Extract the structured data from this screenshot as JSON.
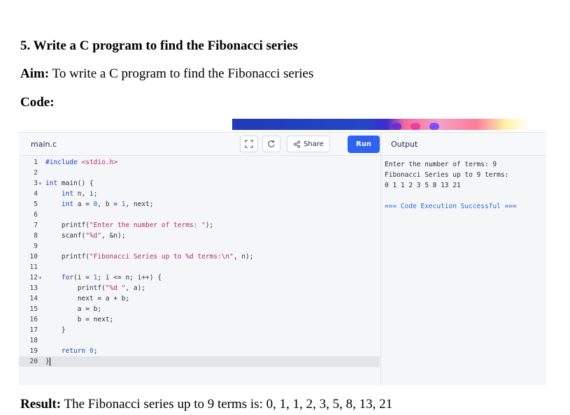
{
  "document": {
    "heading": "5.  Write a C program to find the Fibonacci series",
    "aim_label": "Aim:",
    "aim_text": " To write a C program to find the Fibonacci series",
    "code_label": "Code:",
    "result_label": "Result:",
    "result_text": " The Fibonacci series up to 9 terms is: 0, 1, 1, 2, 3, 5, 8, 13, 21"
  },
  "editor": {
    "file_name": "main.c",
    "share_label": "Share",
    "run_label": "Run",
    "icons": [
      "fullscreen-icon",
      "theme-toggle-icon",
      "share-icon"
    ],
    "lines": [
      {
        "n": "1",
        "code": "#include <stdio.h>"
      },
      {
        "n": "2",
        "code": ""
      },
      {
        "n": "3",
        "code": "int main() {",
        "fold": true
      },
      {
        "n": "4",
        "code": "    int n, i;"
      },
      {
        "n": "5",
        "code": "    int a = 0, b = 1, next;"
      },
      {
        "n": "6",
        "code": ""
      },
      {
        "n": "7",
        "code": "    printf(\"Enter the number of terms: \");"
      },
      {
        "n": "8",
        "code": "    scanf(\"%d\", &n);"
      },
      {
        "n": "9",
        "code": ""
      },
      {
        "n": "10",
        "code": "    printf(\"Fibonacci Series up to %d terms:\\n\", n);"
      },
      {
        "n": "11",
        "code": ""
      },
      {
        "n": "12",
        "code": "    for(i = 1; i <= n; i++) {",
        "fold": true
      },
      {
        "n": "13",
        "code": "        printf(\"%d \", a);"
      },
      {
        "n": "14",
        "code": "        next = a + b;"
      },
      {
        "n": "15",
        "code": "        a = b;"
      },
      {
        "n": "16",
        "code": "        b = next;"
      },
      {
        "n": "17",
        "code": "    }"
      },
      {
        "n": "18",
        "code": ""
      },
      {
        "n": "19",
        "code": "    return 0;"
      },
      {
        "n": "20",
        "code": "}",
        "active": true
      }
    ]
  },
  "output": {
    "label": "Output",
    "lines": [
      "Enter the number of terms: 9",
      "Fibonacci Series up to 9 terms:",
      "0 1 1 2 3 5 8 13 21",
      "",
      "=== Code Execution Successful ==="
    ]
  },
  "colors": {
    "run_button": "#2f62ef",
    "success_text": "#2f6ad6",
    "keyword": "#1f3fbf",
    "string": "#b02f6d"
  }
}
